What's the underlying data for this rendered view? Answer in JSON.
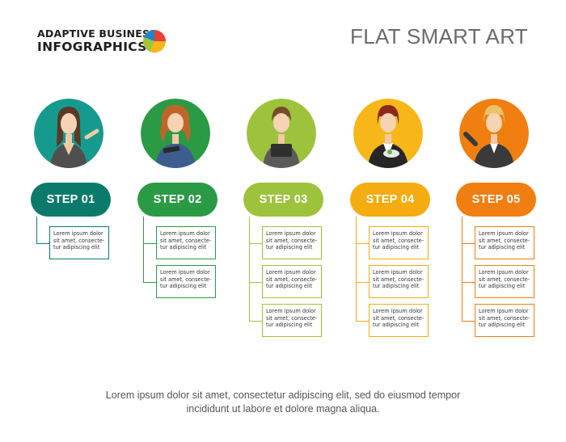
{
  "brand": {
    "line1": "ADAPTIVE BUSINESS",
    "line2": "INFOGRAPHICS"
  },
  "title": "FLAT SMART ART",
  "steps": [
    {
      "label": "STEP 01",
      "color": "#0c7a6a",
      "items": [
        "Lorem ipsum dolor sit amet, consecte-tur adipiscing elit"
      ]
    },
    {
      "label": "STEP 02",
      "color": "#2b9a45",
      "items": [
        "Lorem ipsum dolor sit amet, consecte-tur adipiscing elit",
        "Lorem ipsum dolor sit amet, consecte-tur adipiscing elit"
      ]
    },
    {
      "label": "STEP 03",
      "color": "#9dc23c",
      "items": [
        "Lorem ipsum dolor sit amet, consecte-tur adipiscing elit",
        "Lorem ipsum dolor sit amet, consecte-tur adipiscing elit",
        "Lorem ipsum dolor sit amet, consecte-tur adipiscing elit"
      ]
    },
    {
      "label": "STEP 04",
      "color": "#f4ac10",
      "items": [
        "Lorem ipsum dolor sit amet, consecte-tur adipiscing elit",
        "Lorem ipsum dolor sit amet, consecte-tur adipiscing elit",
        "Lorem ipsum dolor sit amet, consecte-tur adipiscing elit"
      ]
    },
    {
      "label": "STEP 05",
      "color": "#f07e10",
      "items": [
        "Lorem ipsum dolor sit amet, consecte-tur adipiscing elit",
        "Lorem ipsum dolor sit amet, consecte-tur adipiscing elit",
        "Lorem ipsum dolor sit amet, consecte-tur adipiscing elit"
      ]
    }
  ],
  "footer": {
    "line1": "Lorem ipsum dolor sit amet, consectetur adipiscing elit, sed do eiusmod tempor",
    "line2": "incididunt ut labore et dolore magna aliqua."
  }
}
